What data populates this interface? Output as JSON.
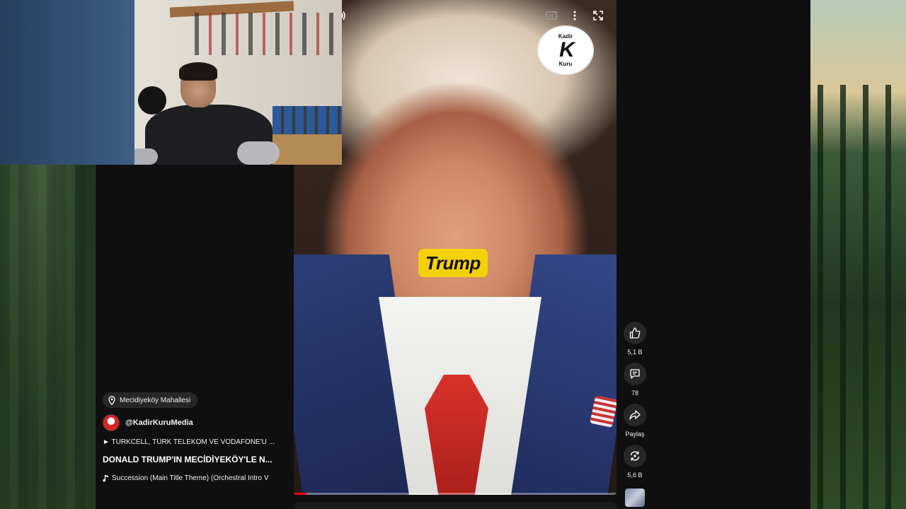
{
  "player": {
    "caption_chip": "Trump",
    "logo_top": "Kadir",
    "logo_mark": "K",
    "logo_bottom": "Kuru",
    "progress_fraction": 0.04
  },
  "info": {
    "location": "Mecidiyeköy Mahallesi",
    "channel": "@KadirKuruMedia",
    "playlist": "► TURKCELL, TÜRK TELEKOM VE VODAFONE'U ...",
    "title": "DONALD TRUMP'IN MECİDİYEKÖY'LE N...",
    "sound": "Succession (Main Title Theme) (Orchestral Intro V"
  },
  "actions": {
    "like_count": "5,1 B",
    "comment_count": "78",
    "share_label": "Paylaş",
    "remix_count": "5,6 B"
  },
  "icons": {
    "pause": "pause-icon",
    "volume": "volume-icon",
    "captions": "closed-captions-icon",
    "more": "more-vert-icon",
    "fullscreen": "fullscreen-icon",
    "location": "location-pin-icon",
    "like": "thumbs-up-icon",
    "comment": "comment-icon",
    "share": "share-arrow-icon",
    "remix": "remix-icon",
    "music": "music-note-icon"
  },
  "colors": {
    "background": "#0f0f0f",
    "chip": "#272727",
    "caption_yellow": "#f5d10a",
    "progress": "#ff0000"
  }
}
